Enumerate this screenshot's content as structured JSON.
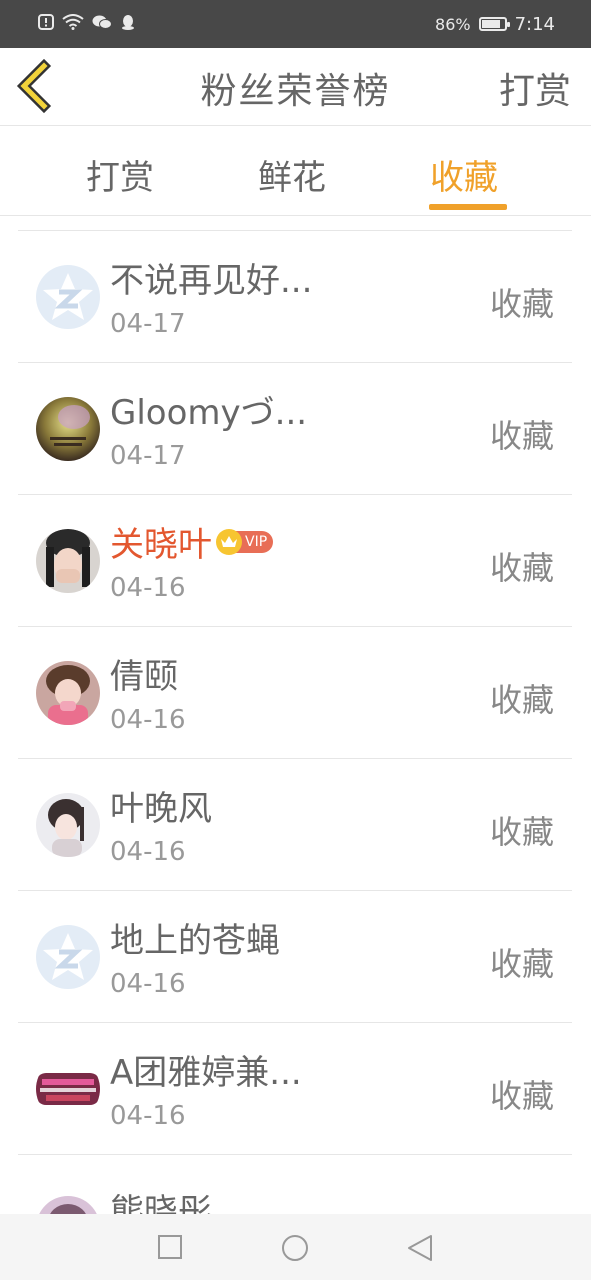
{
  "status_bar": {
    "battery_text": "86%",
    "battery_level": 0.86,
    "time": "7:14",
    "icons": [
      "alert-icon",
      "wifi-icon",
      "wechat-icon",
      "qq-icon"
    ]
  },
  "header": {
    "title": "粉丝荣誉榜",
    "right_action": "打赏",
    "back_icon": "chevron-left-icon"
  },
  "tabs": [
    {
      "label": "打赏",
      "active": false
    },
    {
      "label": "鲜花",
      "active": false
    },
    {
      "label": "收藏",
      "active": true
    }
  ],
  "accent_color": "#f0a12a",
  "vip_name_color": "#e3572f",
  "rows": [
    {
      "name": "不说再见好...",
      "date": "04-17",
      "action": "收藏",
      "avatar": "qzone-default-avatar"
    },
    {
      "name": "Gloomyづ...",
      "date": "04-17",
      "action": "收藏",
      "avatar": "user-avatar"
    },
    {
      "name": "关晓叶",
      "date": "04-16",
      "action": "收藏",
      "avatar": "user-avatar",
      "vip_badge": "VIP"
    },
    {
      "name": "倩颐",
      "date": "04-16",
      "action": "收藏",
      "avatar": "user-avatar"
    },
    {
      "name": "叶晚风",
      "date": "04-16",
      "action": "收藏",
      "avatar": "user-avatar"
    },
    {
      "name": "地上的苍蝇",
      "date": "04-16",
      "action": "收藏",
      "avatar": "qzone-default-avatar"
    },
    {
      "name": "A团雅婷兼...",
      "date": "04-16",
      "action": "收藏",
      "avatar": "user-avatar"
    }
  ],
  "partial_row": {
    "name": "熊晓彤"
  }
}
